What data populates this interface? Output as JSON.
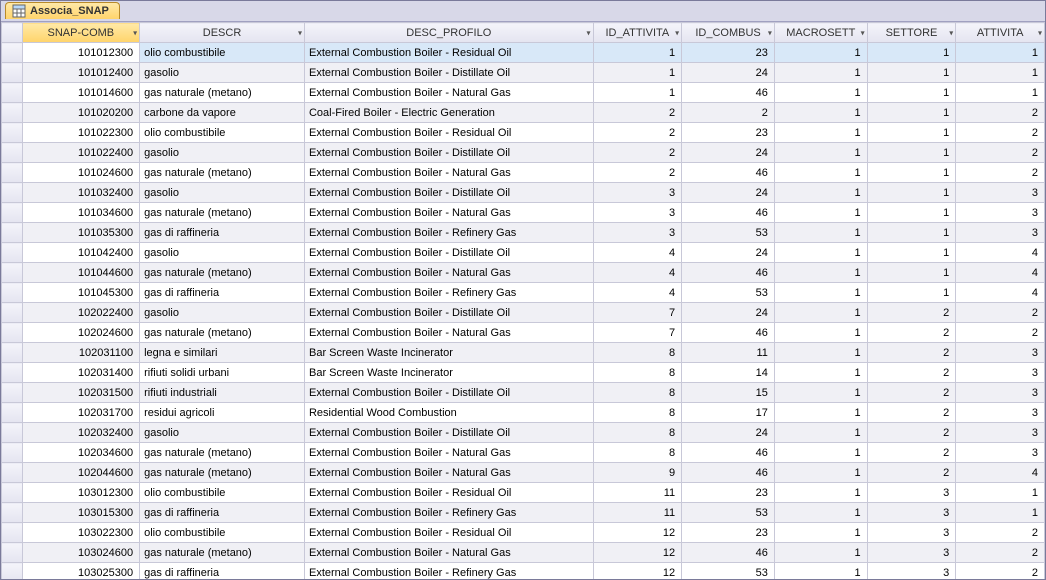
{
  "tab": {
    "title": "Associa_SNAP"
  },
  "columns": [
    {
      "label": "SNAP-COMB",
      "sort": true
    },
    {
      "label": "DESCR",
      "sort": false
    },
    {
      "label": "DESC_PROFILO",
      "sort": false
    },
    {
      "label": "ID_ATTIVITA",
      "sort": false
    },
    {
      "label": "ID_COMBUS",
      "sort": false
    },
    {
      "label": "MACROSETT",
      "sort": false
    },
    {
      "label": "SETTORE",
      "sort": false
    },
    {
      "label": "ATTIVITA",
      "sort": false
    }
  ],
  "rows": [
    {
      "snap": "101012300",
      "descr": "olio combustibile",
      "prof": "External Combustion Boiler - Residual Oil",
      "id_att": 1,
      "id_comb": 23,
      "macro": 1,
      "sett": 1,
      "activ": 1,
      "selected": true,
      "editing": true
    },
    {
      "snap": "101012400",
      "descr": "gasolio",
      "prof": "External Combustion Boiler - Distillate Oil",
      "id_att": 1,
      "id_comb": 24,
      "macro": 1,
      "sett": 1,
      "activ": 1
    },
    {
      "snap": "101014600",
      "descr": "gas naturale (metano)",
      "prof": "External Combustion Boiler - Natural Gas",
      "id_att": 1,
      "id_comb": 46,
      "macro": 1,
      "sett": 1,
      "activ": 1
    },
    {
      "snap": "101020200",
      "descr": "carbone da vapore",
      "prof": "Coal-Fired Boiler - Electric Generation",
      "id_att": 2,
      "id_comb": 2,
      "macro": 1,
      "sett": 1,
      "activ": 2
    },
    {
      "snap": "101022300",
      "descr": "olio combustibile",
      "prof": "External Combustion Boiler - Residual Oil",
      "id_att": 2,
      "id_comb": 23,
      "macro": 1,
      "sett": 1,
      "activ": 2
    },
    {
      "snap": "101022400",
      "descr": "gasolio",
      "prof": "External Combustion Boiler - Distillate Oil",
      "id_att": 2,
      "id_comb": 24,
      "macro": 1,
      "sett": 1,
      "activ": 2
    },
    {
      "snap": "101024600",
      "descr": "gas naturale (metano)",
      "prof": "External Combustion Boiler - Natural Gas",
      "id_att": 2,
      "id_comb": 46,
      "macro": 1,
      "sett": 1,
      "activ": 2
    },
    {
      "snap": "101032400",
      "descr": "gasolio",
      "prof": "External Combustion Boiler - Distillate Oil",
      "id_att": 3,
      "id_comb": 24,
      "macro": 1,
      "sett": 1,
      "activ": 3
    },
    {
      "snap": "101034600",
      "descr": "gas naturale (metano)",
      "prof": "External Combustion Boiler - Natural Gas",
      "id_att": 3,
      "id_comb": 46,
      "macro": 1,
      "sett": 1,
      "activ": 3
    },
    {
      "snap": "101035300",
      "descr": "gas di raffineria",
      "prof": "External Combustion Boiler - Refinery Gas",
      "id_att": 3,
      "id_comb": 53,
      "macro": 1,
      "sett": 1,
      "activ": 3
    },
    {
      "snap": "101042400",
      "descr": "gasolio",
      "prof": "External Combustion Boiler - Distillate Oil",
      "id_att": 4,
      "id_comb": 24,
      "macro": 1,
      "sett": 1,
      "activ": 4
    },
    {
      "snap": "101044600",
      "descr": "gas naturale (metano)",
      "prof": "External Combustion Boiler - Natural Gas",
      "id_att": 4,
      "id_comb": 46,
      "macro": 1,
      "sett": 1,
      "activ": 4
    },
    {
      "snap": "101045300",
      "descr": "gas di raffineria",
      "prof": "External Combustion Boiler - Refinery Gas",
      "id_att": 4,
      "id_comb": 53,
      "macro": 1,
      "sett": 1,
      "activ": 4
    },
    {
      "snap": "102022400",
      "descr": "gasolio",
      "prof": "External Combustion Boiler - Distillate Oil",
      "id_att": 7,
      "id_comb": 24,
      "macro": 1,
      "sett": 2,
      "activ": 2
    },
    {
      "snap": "102024600",
      "descr": "gas naturale (metano)",
      "prof": "External Combustion Boiler - Natural Gas",
      "id_att": 7,
      "id_comb": 46,
      "macro": 1,
      "sett": 2,
      "activ": 2
    },
    {
      "snap": "102031100",
      "descr": "legna e similari",
      "prof": "Bar Screen Waste Incinerator",
      "id_att": 8,
      "id_comb": 11,
      "macro": 1,
      "sett": 2,
      "activ": 3
    },
    {
      "snap": "102031400",
      "descr": "rifiuti solidi urbani",
      "prof": "Bar Screen Waste Incinerator",
      "id_att": 8,
      "id_comb": 14,
      "macro": 1,
      "sett": 2,
      "activ": 3
    },
    {
      "snap": "102031500",
      "descr": "rifiuti industriali",
      "prof": "External Combustion Boiler - Distillate Oil",
      "id_att": 8,
      "id_comb": 15,
      "macro": 1,
      "sett": 2,
      "activ": 3
    },
    {
      "snap": "102031700",
      "descr": "residui agricoli",
      "prof": "Residential Wood Combustion",
      "id_att": 8,
      "id_comb": 17,
      "macro": 1,
      "sett": 2,
      "activ": 3
    },
    {
      "snap": "102032400",
      "descr": "gasolio",
      "prof": "External Combustion Boiler - Distillate Oil",
      "id_att": 8,
      "id_comb": 24,
      "macro": 1,
      "sett": 2,
      "activ": 3
    },
    {
      "snap": "102034600",
      "descr": "gas naturale (metano)",
      "prof": "External Combustion Boiler - Natural Gas",
      "id_att": 8,
      "id_comb": 46,
      "macro": 1,
      "sett": 2,
      "activ": 3
    },
    {
      "snap": "102044600",
      "descr": "gas naturale (metano)",
      "prof": "External Combustion Boiler - Natural Gas",
      "id_att": 9,
      "id_comb": 46,
      "macro": 1,
      "sett": 2,
      "activ": 4
    },
    {
      "snap": "103012300",
      "descr": "olio combustibile",
      "prof": "External Combustion Boiler - Residual Oil",
      "id_att": 11,
      "id_comb": 23,
      "macro": 1,
      "sett": 3,
      "activ": 1
    },
    {
      "snap": "103015300",
      "descr": "gas di raffineria",
      "prof": "External Combustion Boiler - Refinery Gas",
      "id_att": 11,
      "id_comb": 53,
      "macro": 1,
      "sett": 3,
      "activ": 1
    },
    {
      "snap": "103022300",
      "descr": "olio combustibile",
      "prof": "External Combustion Boiler - Residual Oil",
      "id_att": 12,
      "id_comb": 23,
      "macro": 1,
      "sett": 3,
      "activ": 2
    },
    {
      "snap": "103024600",
      "descr": "gas naturale (metano)",
      "prof": "External Combustion Boiler - Natural Gas",
      "id_att": 12,
      "id_comb": 46,
      "macro": 1,
      "sett": 3,
      "activ": 2
    },
    {
      "snap": "103025300",
      "descr": "gas di raffineria",
      "prof": "External Combustion Boiler - Refinery Gas",
      "id_att": 12,
      "id_comb": 53,
      "macro": 1,
      "sett": 3,
      "activ": 2
    }
  ]
}
